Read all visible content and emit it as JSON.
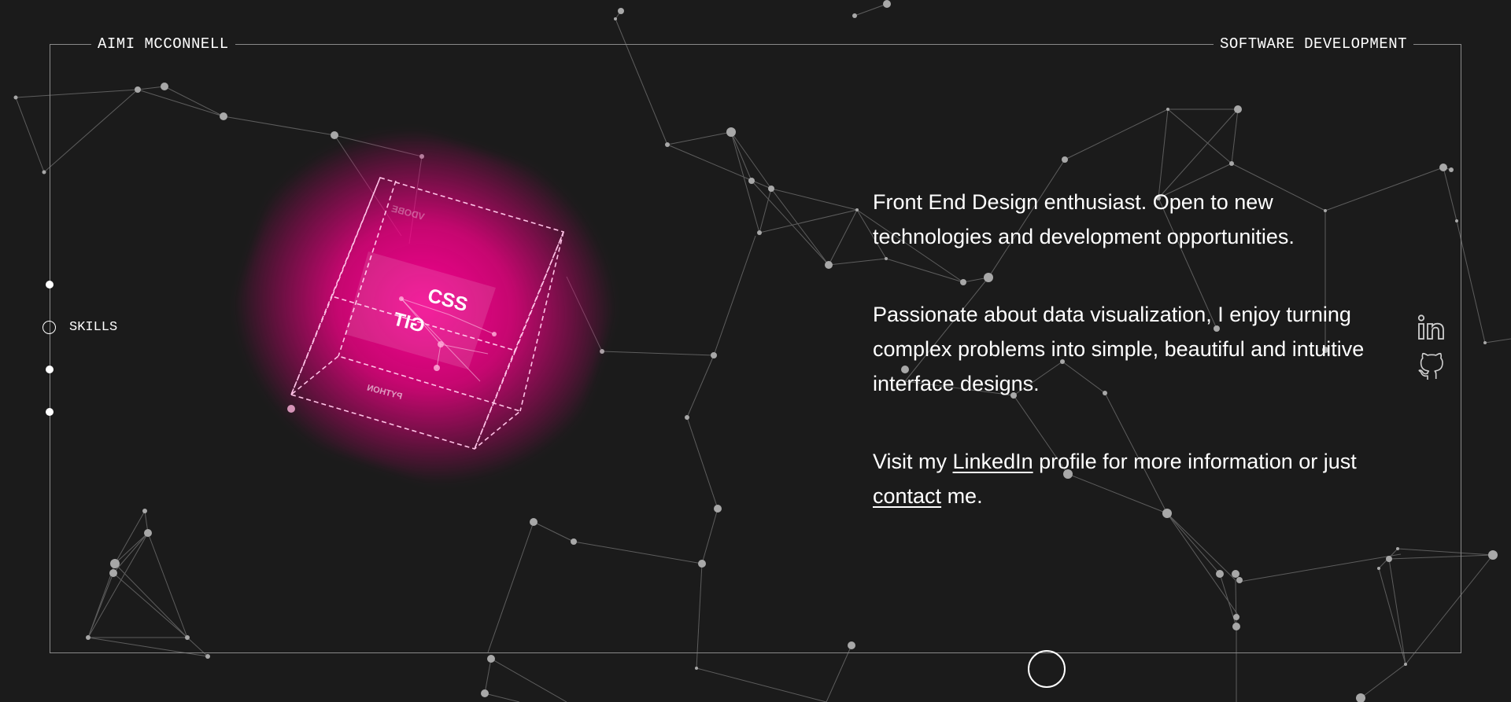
{
  "header": {
    "name": "AIMI MCCONNELL",
    "role": "SOFTWARE DEVELOPMENT"
  },
  "nav": {
    "active_label": "SKILLS"
  },
  "cube": {
    "labels": [
      "CSS",
      "GIT",
      "VDOBE",
      "PYTHON"
    ]
  },
  "content": {
    "p1": "Front End Design enthusiast. Open to new technologies and development opportunities.",
    "p2": "Passionate about data visualization, I enjoy turning complex problems into simple, beautiful and intuitive interface designs.",
    "p3_prefix": "Visit my ",
    "p3_link1": "LinkedIn",
    "p3_middle": " profile for more information or just ",
    "p3_link2": "contact",
    "p3_suffix": " me."
  },
  "social": {
    "icons": [
      "linkedin-icon",
      "github-icon"
    ]
  },
  "colors": {
    "background": "#1b1b1b",
    "accent": "#ff1493",
    "text": "#ffffff",
    "frame": "#8a8a8a"
  }
}
